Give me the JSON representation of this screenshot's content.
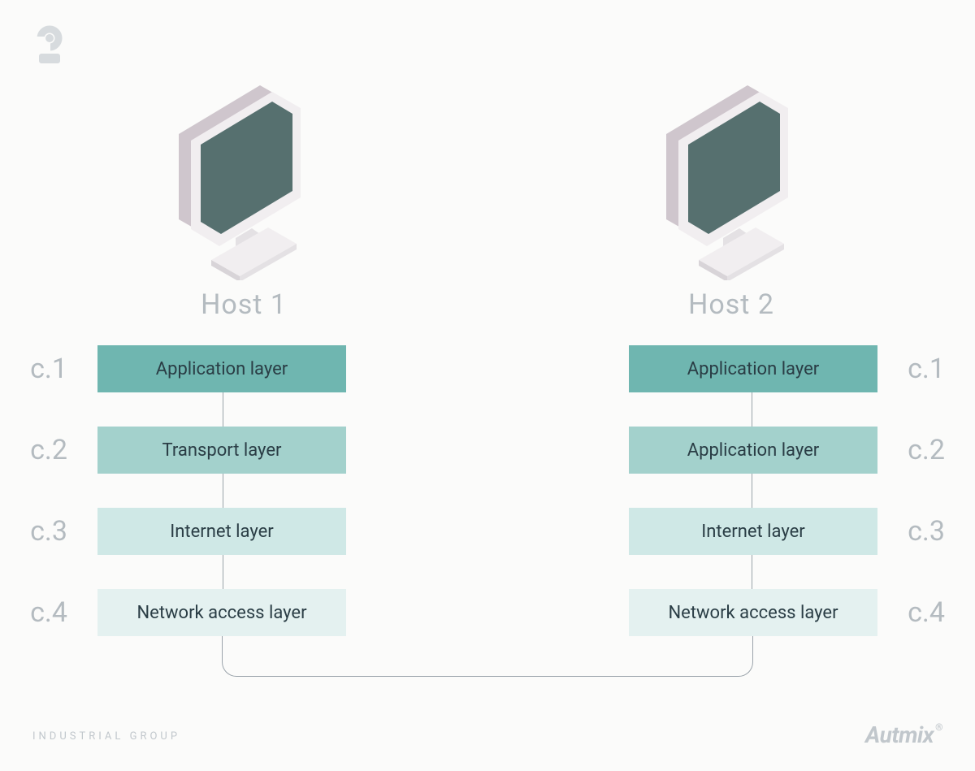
{
  "hosts": {
    "left_title": "Host 1",
    "right_title": "Host 2"
  },
  "labels": {
    "c1": "c.1",
    "c2": "c.2",
    "c3": "c.3",
    "c4": "c.4"
  },
  "layers": {
    "left": {
      "l1": "Application layer",
      "l2": "Transport layer",
      "l3": "Internet layer",
      "l4": "Network access layer"
    },
    "right": {
      "l1": "Application layer",
      "l2": "Application layer",
      "l3": "Internet layer",
      "l4": "Network access layer"
    }
  },
  "footer": {
    "left": "INDUSTRIAL GROUP",
    "right": "Autmix"
  },
  "colors": {
    "c1": "#6fb6b0",
    "c2": "#a3d1cc",
    "c3": "#cfe8e6",
    "c4": "#e4f1f0",
    "muted": "#b4bbc0"
  }
}
